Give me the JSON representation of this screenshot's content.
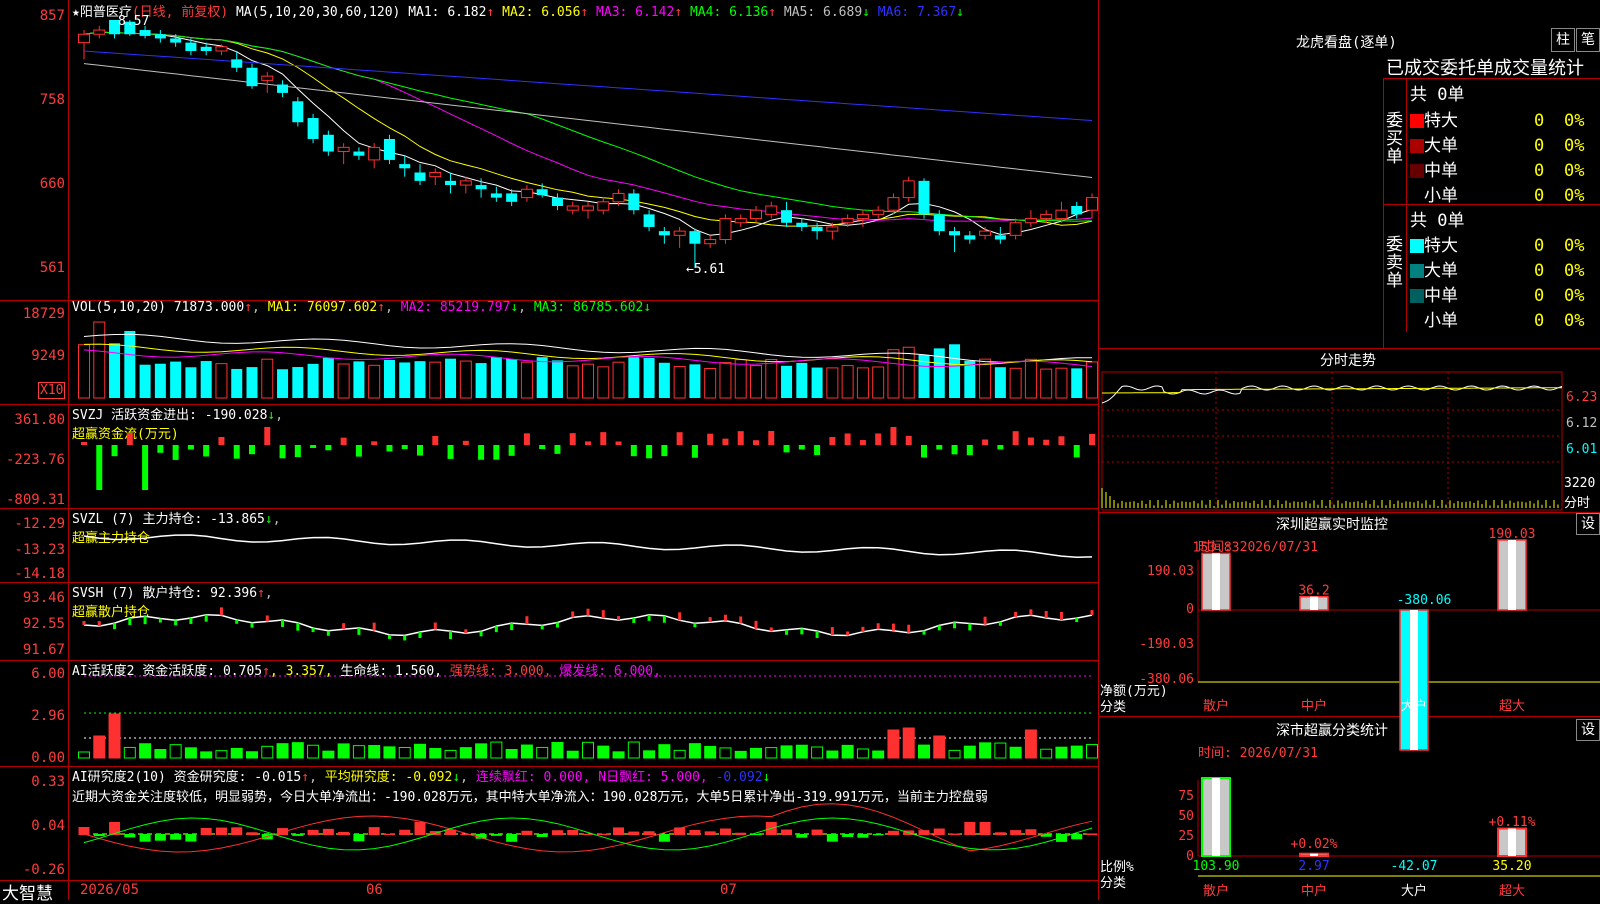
{
  "app": {
    "brand": "大智慧",
    "star": "★",
    "stock_name": "阳普医疗",
    "period_note": "(日线, 前复权)"
  },
  "main": {
    "ma_legend": "MA(5,10,20,30,60,120)",
    "ma": [
      {
        "label": "MA1:",
        "value": "6.182",
        "arrow": "↑",
        "color": "#ffffff"
      },
      {
        "label": "MA2:",
        "value": "6.056",
        "arrow": "↑",
        "color": "#ffff00"
      },
      {
        "label": "MA3:",
        "value": "6.142",
        "arrow": "↑",
        "color": "#ff00ff"
      },
      {
        "label": "MA4:",
        "value": "6.136",
        "arrow": "↑",
        "color": "#00ff00"
      },
      {
        "label": "MA5:",
        "value": "6.689",
        "arrow": "↓",
        "color": "#c0c0c0"
      },
      {
        "label": "MA6:",
        "value": "7.367",
        "arrow": "↓",
        "color": "#3030ff"
      }
    ],
    "y_ticks": [
      "857",
      "758",
      "660",
      "561"
    ],
    "high_label": "8.57",
    "low_label": "←5.61"
  },
  "volume": {
    "legend": "VOL(5,10,20)",
    "vol_value": "71873.000",
    "ma1": "MA1: 76097.602",
    "ma2": "MA2: 85219.797",
    "ma3": "MA3: 86785.602",
    "y_ticks": [
      "18729",
      "9249"
    ],
    "unit": "X10"
  },
  "svzj": {
    "legend": "SVZJ  活跃资金进出: -190.028",
    "sub": "超赢资金流(万元)",
    "y_ticks": [
      "361.80",
      "-223.76",
      "-809.31"
    ]
  },
  "svzl": {
    "legend": "SVZL (7) 主力持仓: -13.865",
    "sub": "超赢主力持仓",
    "y_ticks": [
      "-12.29",
      "-13.23",
      "-14.18"
    ]
  },
  "svsh": {
    "legend": "SVSH (7) 散户持仓: 92.396",
    "sub": "超赢散户持仓",
    "y_ticks": [
      "93.46",
      "92.55",
      "91.67"
    ]
  },
  "ai_active": {
    "legend_a": "AI活跃度2 资金活跃度: 0.705",
    "legend_b": ", 3.357,",
    "legend_c": "生命线: 1.560,",
    "legend_d": "强势线: 3.000,",
    "legend_e": "爆发线: 6.000,",
    "y_ticks": [
      "6.00",
      "2.96",
      "0.00"
    ]
  },
  "ai_research": {
    "legend_a": "AI研究度2(10) 资金研究度: -0.015",
    "legend_b": "平均研究度: -0.092",
    "legend_c": "连续飘红: 0.000,",
    "legend_d": "N日飘红: 5.000,",
    "legend_e": "-0.092",
    "comment": "近期大资金关注度较低，明显弱势，今日大单净流出：-190.028万元，其中特大单净流入：190.028万元，大单5日累计净出-319.991万元，当前主力控盘弱",
    "y_ticks": [
      "0.33",
      "0.04",
      "-0.26"
    ]
  },
  "x_axis": [
    "2026/05",
    "06",
    "07"
  ],
  "dragon_tiger": {
    "title": "龙虎看盘(逐单)",
    "btn_bar": "柱",
    "btn_pen": "笔",
    "header": "已成交委托单成交量统计",
    "buy_side": "委买单",
    "sell_side": "委卖单",
    "buy_total": "共 0单",
    "sell_total": "共 0单",
    "buy_rows": [
      {
        "label": "特大",
        "count": "0",
        "pct": "0%",
        "color": "#ff0000"
      },
      {
        "label": "大单",
        "count": "0",
        "pct": "0%",
        "color": "#aa0000"
      },
      {
        "label": "中单",
        "count": "0",
        "pct": "0%",
        "color": "#660000"
      },
      {
        "label": "小单",
        "count": "0",
        "pct": "0%",
        "color": "#000000"
      }
    ],
    "sell_rows": [
      {
        "label": "特大",
        "count": "0",
        "pct": "0%",
        "color": "#00ffff"
      },
      {
        "label": "大单",
        "count": "0",
        "pct": "0%",
        "color": "#008080"
      },
      {
        "label": "中单",
        "count": "0",
        "pct": "0%",
        "color": "#006060"
      },
      {
        "label": "小单",
        "count": "0",
        "pct": "0%",
        "color": "#000000"
      }
    ]
  },
  "intraday": {
    "title": "分时走势",
    "y_ticks": [
      "6.23",
      "6.12",
      "6.01"
    ],
    "vol_tick": "3220",
    "vol_unit": "分时"
  },
  "monitor": {
    "title": "深圳超赢实时监控",
    "settings": "设",
    "time": "时间: 2026/07/31",
    "y_ticks": [
      "190.03",
      "0",
      "-190.03",
      "-380.06"
    ],
    "y_title": "净额(万元)",
    "x_title": "分类",
    "bars": [
      {
        "cat": "散户",
        "value": 153.83,
        "label": "153.83"
      },
      {
        "cat": "中户",
        "value": 36.2,
        "label": "36.2"
      },
      {
        "cat": "大户",
        "value": -380.06,
        "label": "-380.06"
      },
      {
        "cat": "超大",
        "value": 190.03,
        "label": "190.03"
      }
    ]
  },
  "classify": {
    "title": "深市超赢分类统计",
    "settings": "设",
    "time": "时间: 2026/07/31",
    "y_ticks": [
      "75",
      "50",
      "25",
      "0"
    ],
    "y_title": "比例%",
    "x_title": "分类",
    "bars": [
      {
        "cat": "散户",
        "value": 103.9,
        "label": "103.90",
        "top": ""
      },
      {
        "cat": "中户",
        "value": 2.97,
        "label": "2.97",
        "top": "+0.02%"
      },
      {
        "cat": "大户",
        "value": -42.07,
        "label": "-42.07",
        "top": ""
      },
      {
        "cat": "超大",
        "value": 35.2,
        "label": "35.20",
        "top": "+0.11%"
      }
    ]
  },
  "chart_data": {
    "type": "candlestick",
    "title": "阳普医疗 (日线, 前复权)",
    "ylim": [
      5.61,
      8.57
    ],
    "annotations": [
      "8.57",
      "←5.61"
    ],
    "candles": [
      {
        "o": 8.3,
        "h": 8.45,
        "l": 8.1,
        "c": 8.4,
        "up": true
      },
      {
        "o": 8.4,
        "h": 8.5,
        "l": 8.35,
        "c": 8.45,
        "up": true
      },
      {
        "o": 8.57,
        "h": 8.57,
        "l": 8.35,
        "c": 8.4,
        "up": false
      },
      {
        "o": 8.55,
        "h": 8.57,
        "l": 8.38,
        "c": 8.4,
        "up": false
      },
      {
        "o": 8.45,
        "h": 8.5,
        "l": 8.35,
        "c": 8.38,
        "up": false
      },
      {
        "o": 8.4,
        "h": 8.45,
        "l": 8.3,
        "c": 8.35,
        "up": false
      },
      {
        "o": 8.35,
        "h": 8.4,
        "l": 8.25,
        "c": 8.3,
        "up": false
      },
      {
        "o": 8.3,
        "h": 8.35,
        "l": 8.15,
        "c": 8.2,
        "up": false
      },
      {
        "o": 8.25,
        "h": 8.3,
        "l": 8.15,
        "c": 8.2,
        "up": false
      },
      {
        "o": 8.2,
        "h": 8.28,
        "l": 8.15,
        "c": 8.25,
        "up": true
      },
      {
        "o": 8.1,
        "h": 8.2,
        "l": 7.95,
        "c": 8.0,
        "up": false
      },
      {
        "o": 8.0,
        "h": 8.05,
        "l": 7.75,
        "c": 7.78,
        "up": false
      },
      {
        "o": 7.85,
        "h": 7.95,
        "l": 7.7,
        "c": 7.9,
        "up": true
      },
      {
        "o": 7.8,
        "h": 7.85,
        "l": 7.65,
        "c": 7.7,
        "up": false
      },
      {
        "o": 7.6,
        "h": 7.65,
        "l": 7.3,
        "c": 7.35,
        "up": false
      },
      {
        "o": 7.4,
        "h": 7.45,
        "l": 7.1,
        "c": 7.15,
        "up": false
      },
      {
        "o": 7.2,
        "h": 7.25,
        "l": 6.95,
        "c": 7.0,
        "up": false
      },
      {
        "o": 7.0,
        "h": 7.1,
        "l": 6.85,
        "c": 7.05,
        "up": true
      },
      {
        "o": 7.0,
        "h": 7.05,
        "l": 6.9,
        "c": 6.95,
        "up": false
      },
      {
        "o": 6.9,
        "h": 7.1,
        "l": 6.8,
        "c": 7.05,
        "up": true
      },
      {
        "o": 7.15,
        "h": 7.2,
        "l": 6.85,
        "c": 6.9,
        "up": false
      },
      {
        "o": 6.85,
        "h": 6.95,
        "l": 6.7,
        "c": 6.8,
        "up": false
      },
      {
        "o": 6.75,
        "h": 6.85,
        "l": 6.6,
        "c": 6.65,
        "up": false
      },
      {
        "o": 6.7,
        "h": 6.8,
        "l": 6.6,
        "c": 6.75,
        "up": true
      },
      {
        "o": 6.65,
        "h": 6.75,
        "l": 6.5,
        "c": 6.6,
        "up": false
      },
      {
        "o": 6.6,
        "h": 6.7,
        "l": 6.5,
        "c": 6.65,
        "up": true
      },
      {
        "o": 6.6,
        "h": 6.68,
        "l": 6.45,
        "c": 6.55,
        "up": false
      },
      {
        "o": 6.5,
        "h": 6.58,
        "l": 6.4,
        "c": 6.45,
        "up": false
      },
      {
        "o": 6.5,
        "h": 6.55,
        "l": 6.35,
        "c": 6.4,
        "up": false
      },
      {
        "o": 6.45,
        "h": 6.6,
        "l": 6.4,
        "c": 6.55,
        "up": true
      },
      {
        "o": 6.55,
        "h": 6.62,
        "l": 6.45,
        "c": 6.48,
        "up": false
      },
      {
        "o": 6.45,
        "h": 6.5,
        "l": 6.3,
        "c": 6.35,
        "up": false
      },
      {
        "o": 6.3,
        "h": 6.4,
        "l": 6.25,
        "c": 6.35,
        "up": true
      },
      {
        "o": 6.35,
        "h": 6.4,
        "l": 6.2,
        "c": 6.3,
        "up": true
      },
      {
        "o": 6.3,
        "h": 6.45,
        "l": 6.25,
        "c": 6.4,
        "up": true
      },
      {
        "o": 6.4,
        "h": 6.55,
        "l": 6.35,
        "c": 6.5,
        "up": true
      },
      {
        "o": 6.5,
        "h": 6.55,
        "l": 6.25,
        "c": 6.3,
        "up": false
      },
      {
        "o": 6.25,
        "h": 6.3,
        "l": 6.05,
        "c": 6.1,
        "up": false
      },
      {
        "o": 6.05,
        "h": 6.1,
        "l": 5.9,
        "c": 6.0,
        "up": false
      },
      {
        "o": 6.0,
        "h": 6.1,
        "l": 5.85,
        "c": 6.05,
        "up": true
      },
      {
        "o": 6.05,
        "h": 6.08,
        "l": 5.61,
        "c": 5.9,
        "up": false
      },
      {
        "o": 5.9,
        "h": 6.0,
        "l": 5.85,
        "c": 5.95,
        "up": true
      },
      {
        "o": 5.95,
        "h": 6.25,
        "l": 5.9,
        "c": 6.2,
        "up": true
      },
      {
        "o": 6.15,
        "h": 6.25,
        "l": 6.1,
        "c": 6.2,
        "up": true
      },
      {
        "o": 6.2,
        "h": 6.35,
        "l": 6.15,
        "c": 6.3,
        "up": true
      },
      {
        "o": 6.35,
        "h": 6.4,
        "l": 6.2,
        "c": 6.25,
        "up": true
      },
      {
        "o": 6.3,
        "h": 6.4,
        "l": 6.1,
        "c": 6.15,
        "up": false
      },
      {
        "o": 6.15,
        "h": 6.2,
        "l": 6.05,
        "c": 6.1,
        "up": false
      },
      {
        "o": 6.1,
        "h": 6.15,
        "l": 5.95,
        "c": 6.05,
        "up": false
      },
      {
        "o": 6.05,
        "h": 6.15,
        "l": 5.95,
        "c": 6.1,
        "up": true
      },
      {
        "o": 6.15,
        "h": 6.25,
        "l": 6.1,
        "c": 6.2,
        "up": true
      },
      {
        "o": 6.2,
        "h": 6.3,
        "l": 6.1,
        "c": 6.25,
        "up": true
      },
      {
        "o": 6.25,
        "h": 6.35,
        "l": 6.2,
        "c": 6.3,
        "up": true
      },
      {
        "o": 6.3,
        "h": 6.5,
        "l": 6.25,
        "c": 6.45,
        "up": true
      },
      {
        "o": 6.45,
        "h": 6.7,
        "l": 6.4,
        "c": 6.65,
        "up": true
      },
      {
        "o": 6.65,
        "h": 6.68,
        "l": 6.2,
        "c": 6.25,
        "up": false
      },
      {
        "o": 6.25,
        "h": 6.3,
        "l": 6.0,
        "c": 6.05,
        "up": false
      },
      {
        "o": 6.05,
        "h": 6.1,
        "l": 5.8,
        "c": 6.0,
        "up": false
      },
      {
        "o": 5.95,
        "h": 6.05,
        "l": 5.9,
        "c": 6.0,
        "up": false
      },
      {
        "o": 6.0,
        "h": 6.1,
        "l": 5.95,
        "c": 6.05,
        "up": true
      },
      {
        "o": 6.0,
        "h": 6.1,
        "l": 5.9,
        "c": 5.95,
        "up": false
      },
      {
        "o": 6.0,
        "h": 6.2,
        "l": 5.95,
        "c": 6.15,
        "up": true
      },
      {
        "o": 6.15,
        "h": 6.3,
        "l": 6.1,
        "c": 6.2,
        "up": true
      },
      {
        "o": 6.2,
        "h": 6.3,
        "l": 6.15,
        "c": 6.25,
        "up": true
      },
      {
        "o": 6.2,
        "h": 6.4,
        "l": 6.15,
        "c": 6.3,
        "up": true
      },
      {
        "o": 6.25,
        "h": 6.4,
        "l": 6.2,
        "c": 6.35,
        "up": false
      },
      {
        "o": 6.3,
        "h": 6.5,
        "l": 6.2,
        "c": 6.45,
        "up": true
      }
    ]
  }
}
